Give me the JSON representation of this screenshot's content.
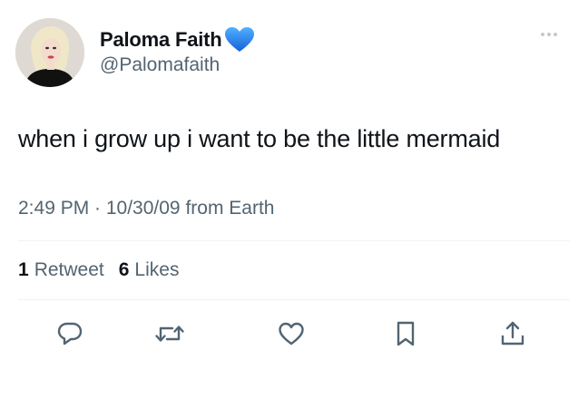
{
  "tweet": {
    "author": {
      "display_name": "Paloma Faith",
      "handle": "@Palomafaith",
      "verified_color": "#1d9bf0",
      "avatar_icon": "profile-photo"
    },
    "text": "when i grow up i want to be the little mermaid",
    "meta": "2:49 PM · 10/30/09 from Earth",
    "stats": {
      "retweets_count": "1",
      "retweets_label": "Retweet",
      "likes_count": "6",
      "likes_label": "Likes"
    },
    "actions": [
      {
        "name": "reply",
        "icon": "speech-bubble-icon"
      },
      {
        "name": "retweet",
        "icon": "retweet-arrows-icon"
      },
      {
        "name": "like",
        "icon": "heart-icon"
      },
      {
        "name": "bookmark",
        "icon": "bookmark-icon"
      },
      {
        "name": "share",
        "icon": "share-up-arrow-icon"
      }
    ],
    "more_icon": "ellipsis-icon"
  },
  "colors": {
    "text_primary": "#0f1419",
    "text_secondary": "#536471",
    "divider": "#eff3f4",
    "icon": "#536471"
  }
}
